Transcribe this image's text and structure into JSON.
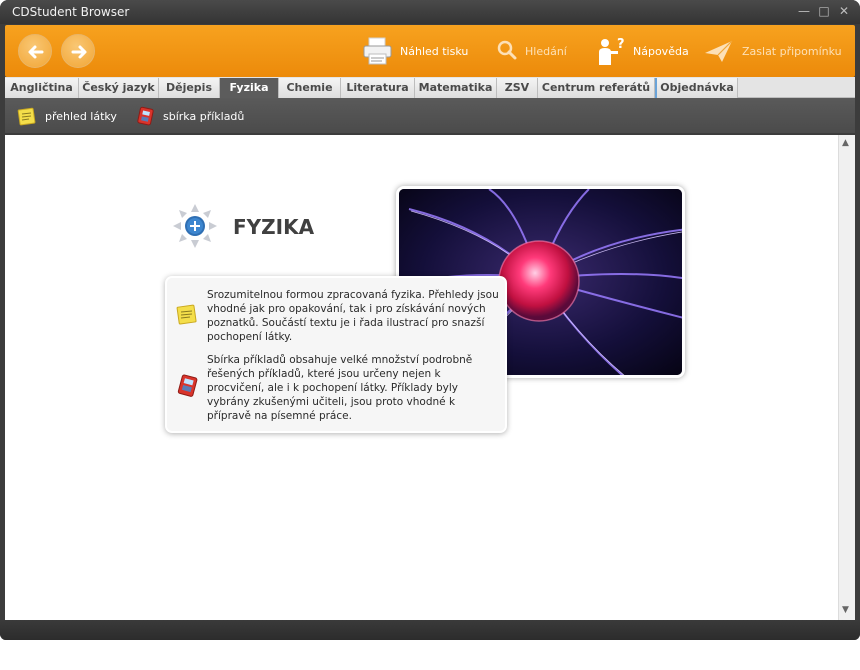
{
  "window": {
    "title": "CDStudent Browser"
  },
  "toolbar": {
    "print_label": "Náhled tisku",
    "search_label": "Hledání",
    "help_label": "Nápověda",
    "send_label": "Zaslat připomínku"
  },
  "tabs": [
    {
      "label": "Angličtina"
    },
    {
      "label": "Český jazyk"
    },
    {
      "label": "Dějepis"
    },
    {
      "label": "Fyzika"
    },
    {
      "label": "Chemie"
    },
    {
      "label": "Literatura"
    },
    {
      "label": "Matematika"
    },
    {
      "label": "ZSV"
    },
    {
      "label": "Centrum referátů"
    },
    {
      "label": "Objednávka"
    }
  ],
  "subnav": [
    {
      "label": "přehled látky"
    },
    {
      "label": "sbírka příkladů"
    }
  ],
  "main": {
    "heading": "FYZIKA",
    "paragraph1": "Srozumitelnou formou zpracovaná fyzika. Přehledy jsou vhodné jak pro opakování, tak i pro získávání nových poznatků. Součástí textu je i řada ilustrací pro snazší pochopení látky.",
    "paragraph2": "Sbírka příkladů obsahuje velké množství podrobně řešených příkladů, které jsou určeny nejen k procvičení, ale i k pochopení látky. Příklady byly vybrány zkušenými učiteli, jsou proto vhodné k přípravě na písemné práce."
  },
  "colors": {
    "toolbar_orange": "#f39a17",
    "active_tab": "#5c5c5c",
    "frame_dark": "#3c3c3c"
  }
}
